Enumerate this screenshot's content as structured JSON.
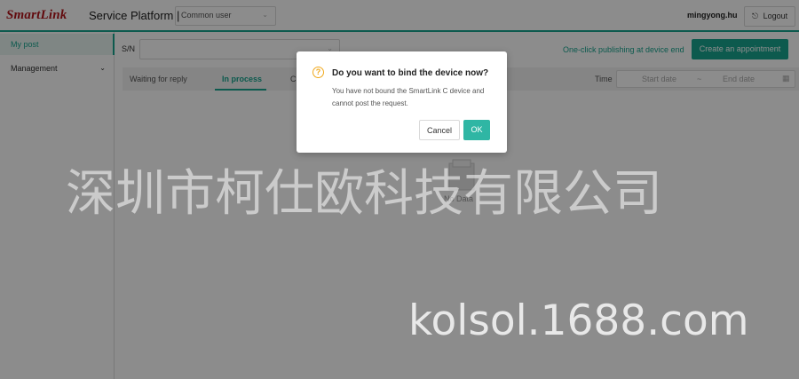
{
  "header": {
    "logo": "SmartLink",
    "platform_title": "Service Platform |",
    "role_select": "Common user",
    "username": "mingyong.hu",
    "logout_label": "Logout"
  },
  "sidebar": {
    "items": [
      {
        "label": "My post",
        "active": true
      },
      {
        "label": "Management",
        "active": false
      }
    ]
  },
  "toolbar": {
    "sn_label": "S/N",
    "sn_value": "",
    "oneclick_label": "One-click publishing at device end",
    "create_button": "Create an appointment"
  },
  "tabs": [
    {
      "label": "Waiting for reply",
      "active": false
    },
    {
      "label": "In process",
      "active": true
    },
    {
      "label": "C",
      "active": false
    }
  ],
  "filter": {
    "time_label": "Time",
    "start_placeholder": "Start date",
    "separator": "~",
    "end_placeholder": "End date"
  },
  "empty_state": {
    "text": "No Data"
  },
  "dialog": {
    "title": "Do you want to bind the device now?",
    "message": "You have not bound the SmartLink C device and cannot post the request.",
    "cancel_label": "Cancel",
    "ok_label": "OK"
  },
  "watermark": {
    "line1": "深圳市柯仕欧科技有限公司",
    "line2": "kolsol.1688.com"
  },
  "colors": {
    "accent": "#18a58f",
    "brand": "#b3141b",
    "warning": "#f0a81c"
  }
}
